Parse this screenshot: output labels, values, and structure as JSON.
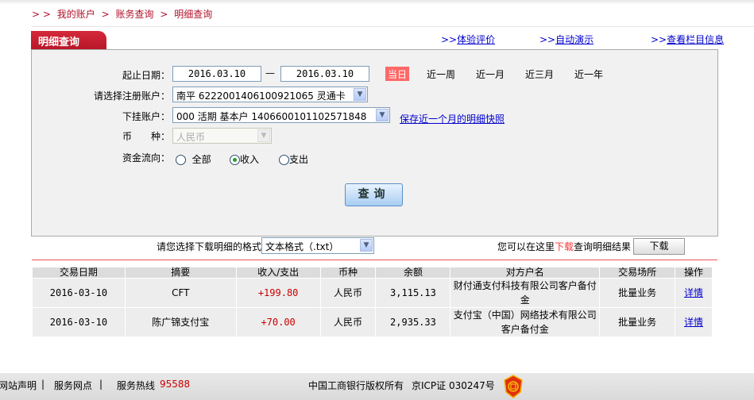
{
  "breadcrumb": {
    "prefix": "> >",
    "items": [
      "我的账户",
      "账务查询",
      "明细查询"
    ],
    "sep": ">"
  },
  "tab": {
    "title": "明细查询"
  },
  "top_links": [
    "体验评价",
    "自动演示",
    "查看栏目信息"
  ],
  "link_prefix": ">>",
  "form": {
    "date_label": "起止日期：",
    "start_date": "2016.03.10",
    "date_sep": "—",
    "end_date": "2016.03.10",
    "quick": [
      "当日",
      "近一周",
      "近一月",
      "近三月",
      "近一年"
    ],
    "account_label": "请选择注册账户：",
    "account_value": "南平 6222001406100921065 灵通卡",
    "sub_label": "下挂账户：",
    "sub_value": "000 活期 基本户 1406600101102571848",
    "snapshot_link": "保存近一个月的明细快照",
    "currency_label": "币　　种：",
    "currency_value": "人民币",
    "flow_label": "资金流向：",
    "flow_options": [
      "全部",
      "收入",
      "支出"
    ],
    "flow_selected": "收入",
    "query_label": "查询"
  },
  "download": {
    "format_label": "请您选择下载明细的格式",
    "format_value": "文本格式（.txt）",
    "hint_pre": "您可以在这里",
    "hint_red": "下载",
    "hint_post": "查询明细结果",
    "button": "下载"
  },
  "table": {
    "headers": [
      "交易日期",
      "摘要",
      "收入/支出",
      "币种",
      "余额",
      "对方户名",
      "交易场所",
      "操作"
    ],
    "rows": [
      [
        "2016-03-10",
        "CFT",
        "+199.80",
        "人民币",
        "3,115.13",
        "财付通支付科技有限公司客户备付金",
        "批量业务",
        "详情"
      ],
      [
        "2016-03-10",
        "陈广锦支付宝",
        "+70.00",
        "人民币",
        "2,935.33",
        "支付宝（中国）网络技术有限公司客户备付金",
        "批量业务",
        "详情"
      ]
    ]
  },
  "footer": {
    "statement": "网站声明",
    "outlets": "服务网点",
    "hotline_label": "服务热线",
    "hotline": "95588",
    "copyright": "中国工商银行版权所有",
    "icp": "京ICP证 030247号",
    "logo_text": "ICBC"
  },
  "colors": {
    "brand": "#b81628",
    "link": "#0000cc",
    "today": "#ff6868"
  }
}
